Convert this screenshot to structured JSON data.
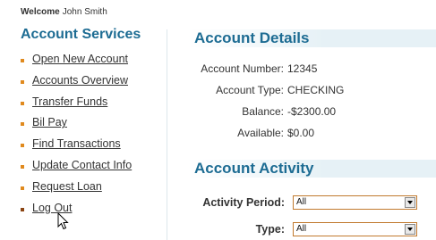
{
  "header": {
    "welcome_label": "Welcome",
    "user_name": "John Smith"
  },
  "sidebar": {
    "title": "Account Services",
    "items": [
      {
        "label": "Open New Account"
      },
      {
        "label": "Accounts Overview"
      },
      {
        "label": "Transfer Funds"
      },
      {
        "label": "Bil Pay"
      },
      {
        "label": "Find Transactions"
      },
      {
        "label": "Update Contact Info"
      },
      {
        "label": "Request Loan"
      },
      {
        "label": "Log Out"
      }
    ]
  },
  "details": {
    "title": "Account Details",
    "account_number_label": "Account Number:",
    "account_number": "12345",
    "account_type_label": "Account Type:",
    "account_type": "CHECKING",
    "balance_label": "Balance:",
    "balance": "-$2300.00",
    "available_label": "Available:",
    "available": "$0.00"
  },
  "activity": {
    "title": "Account Activity",
    "period_label": "Activity Period:",
    "period_value": "All",
    "type_label": "Type:",
    "type_value": "All"
  },
  "colors": {
    "accent": "#1d6c93",
    "bullet": "#e08a1e",
    "select_border": "#c17a2e"
  }
}
